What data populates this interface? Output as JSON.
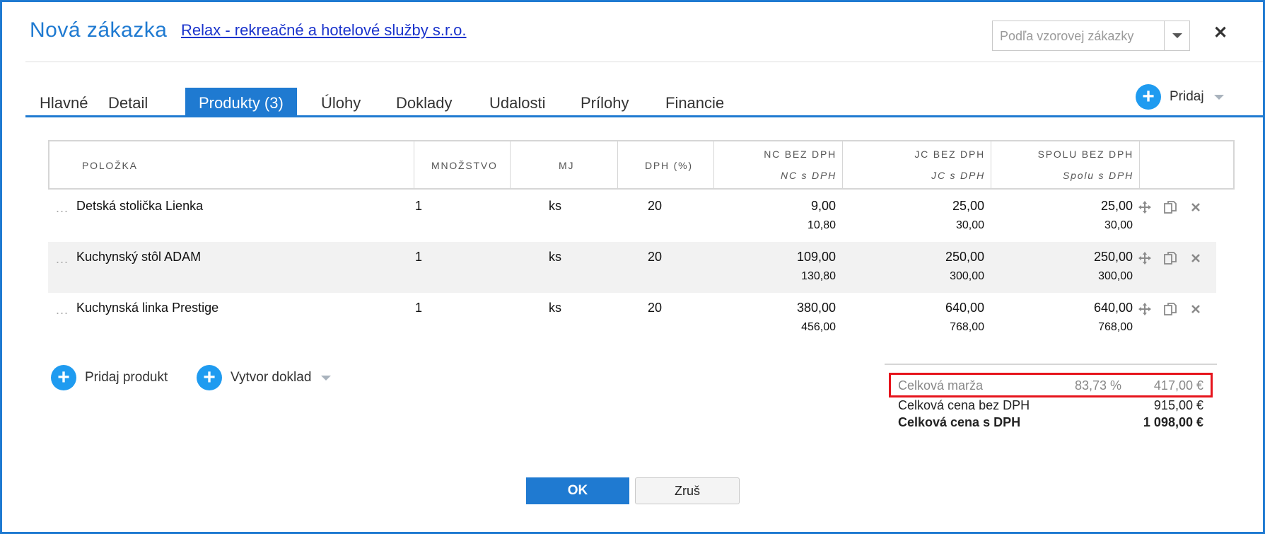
{
  "header": {
    "title": "Nová zákazka",
    "company_link": "Relax - rekreačné a hotelové služby s.r.o.",
    "template_placeholder": "Podľa vzorovej zákazky",
    "close_label": "✕"
  },
  "tabs": [
    {
      "label": "Hlavné"
    },
    {
      "label": "Detail"
    },
    {
      "label": "Produkty (3)"
    },
    {
      "label": "Úlohy"
    },
    {
      "label": "Doklady"
    },
    {
      "label": "Udalosti"
    },
    {
      "label": "Prílohy"
    },
    {
      "label": "Financie"
    }
  ],
  "active_tab": "Produkty (3)",
  "add_button": {
    "label": "Pridaj"
  },
  "table": {
    "headers": {
      "item": "POLOŽKA",
      "quantity": "MNOŽSTVO",
      "unit": "MJ",
      "vat": "DPH (%)",
      "nc": "NC BEZ DPH",
      "nc_vat": "NC s DPH",
      "jc": "JC BEZ DPH",
      "jc_vat": "JC s DPH",
      "total": "SPOLU BEZ DPH",
      "total_vat": "Spolu s DPH"
    },
    "rows": [
      {
        "dots": "...",
        "name": "Detská stolička Lienka",
        "qty": "1",
        "unit": "ks",
        "vat": "20",
        "nc": "9,00",
        "nc_vat": "10,80",
        "jc": "25,00",
        "jc_vat": "30,00",
        "total": "25,00",
        "total_vat": "30,00"
      },
      {
        "dots": "...",
        "name": "Kuchynský stôl ADAM",
        "qty": "1",
        "unit": "ks",
        "vat": "20",
        "nc": "109,00",
        "nc_vat": "130,80",
        "jc": "250,00",
        "jc_vat": "300,00",
        "total": "250,00",
        "total_vat": "300,00"
      },
      {
        "dots": "...",
        "name": "Kuchynská linka Prestige",
        "qty": "1",
        "unit": "ks",
        "vat": "20",
        "nc": "380,00",
        "nc_vat": "456,00",
        "jc": "640,00",
        "jc_vat": "768,00",
        "total": "640,00",
        "total_vat": "768,00"
      }
    ],
    "row_icons": [
      "move-icon",
      "copy-icon",
      "delete-icon"
    ]
  },
  "actions": {
    "add_product": "Pridaj produkt",
    "create_document": "Vytvor doklad"
  },
  "summary": {
    "margin_label": "Celková marža",
    "margin_pct": "83,73 %",
    "margin_value": "417,00 €",
    "net_label": "Celková cena bez DPH",
    "net_value": "915,00 €",
    "gross_label": "Celková cena s DPH",
    "gross_value": "1 098,00 €"
  },
  "footer": {
    "ok": "OK",
    "cancel": "Zruš"
  },
  "colors": {
    "accent": "#1f7ad1",
    "plus": "#1f9bf0",
    "highlight": "#e6141c"
  }
}
